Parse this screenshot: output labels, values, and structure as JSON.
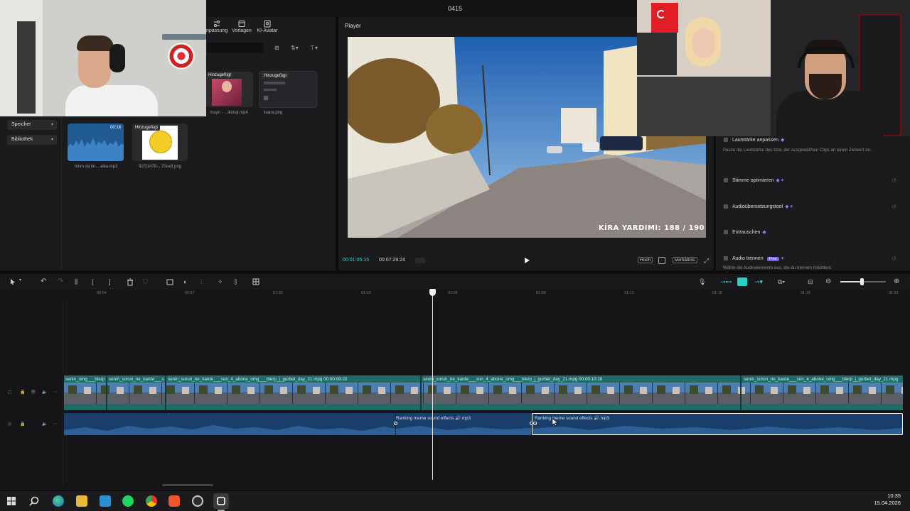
{
  "window": {
    "title": "0415"
  },
  "media_panel": {
    "tabs": [
      {
        "label": "npassung",
        "icon": "sliders-icon"
      },
      {
        "label": "Vorlagen",
        "icon": "template-icon"
      },
      {
        "label": "KI-Avatar",
        "icon": "avatar-icon"
      }
    ],
    "sidebar": [
      {
        "label": "Speicher"
      },
      {
        "label": "Bibliothek"
      }
    ],
    "assets": [
      {
        "badge": "Hinzugefügt",
        "name": "mayn - ...ikoloji.mp4",
        "kind": "video"
      },
      {
        "badge": "Hinzugefügt",
        "name": "kuara.png",
        "kind": "image"
      },
      {
        "duration": "00:16",
        "name": "hmm da kn... alka.mp3",
        "kind": "audio"
      },
      {
        "badge": "Hinzugefügt",
        "name": "91f31478-...70ce8.png",
        "kind": "image"
      }
    ]
  },
  "player": {
    "title": "Player",
    "current_time": "00:01:05:15",
    "total_time": "00:07:29:24",
    "overlay_text": "KİRA YARDIMI:  188 / 190",
    "buttons": {
      "quality": "Hoch",
      "ratio": "Verhältnis"
    }
  },
  "properties": {
    "items": [
      {
        "label": "Lautstärke anpassen",
        "desc": "Passe die Lautstärke des bzw. der ausgewählten Clips an einen Zielwert an."
      },
      {
        "label": "Stimme optimieren",
        "desc": ""
      },
      {
        "label": "Audioübersetzungstool",
        "desc": ""
      },
      {
        "label": "Entrauschen",
        "desc": ""
      },
      {
        "label": "Audio trennen",
        "badge": "Free",
        "desc": "Wähle die Audioelemente aus, die du trennen möchtest."
      }
    ]
  },
  "timeline": {
    "ticks": [
      "00:54",
      "00:57",
      "01:00",
      "01:03",
      "01:06",
      "01:09",
      "01:12",
      "01:15",
      "01:18",
      "01:21"
    ],
    "video_clips": [
      {
        "name": "senin_sorun_ne_karde___son_4_abone_omg___blerp_j_gurbet_day_21.mpg  00:00:08:20"
      },
      {
        "name": "senin_sorun_ne_karde___son_4_abone_omg___blerp_j_gurbet_day_21.mpg  00:00:10:28"
      },
      {
        "name": "senin_sorun_ne_karde___son_4_abone_omg___blerp_j_gurbet_day_21.mpg"
      },
      {
        "name": "senin_sorun_ne_karde___s"
      },
      {
        "name": "senin_omg___blerp"
      }
    ],
    "audio_clips": [
      {
        "name": "Ranking meme sound effects 🔊.mp3"
      },
      {
        "name": "Ranking meme sound effects 🔊.mp3"
      }
    ]
  },
  "taskbar": {
    "time": "10:35",
    "date": "15.04.2026",
    "apps": [
      "windows-start-icon",
      "search-icon",
      "edge-icon",
      "explorer-icon",
      "store-icon",
      "spotify-icon",
      "chrome-icon",
      "brave-icon",
      "obs-icon",
      "capcut-icon"
    ]
  },
  "colors": {
    "video_track": "#1f6b6a",
    "audio_track": "#1a3e6b",
    "accent": "#27d1c6"
  }
}
